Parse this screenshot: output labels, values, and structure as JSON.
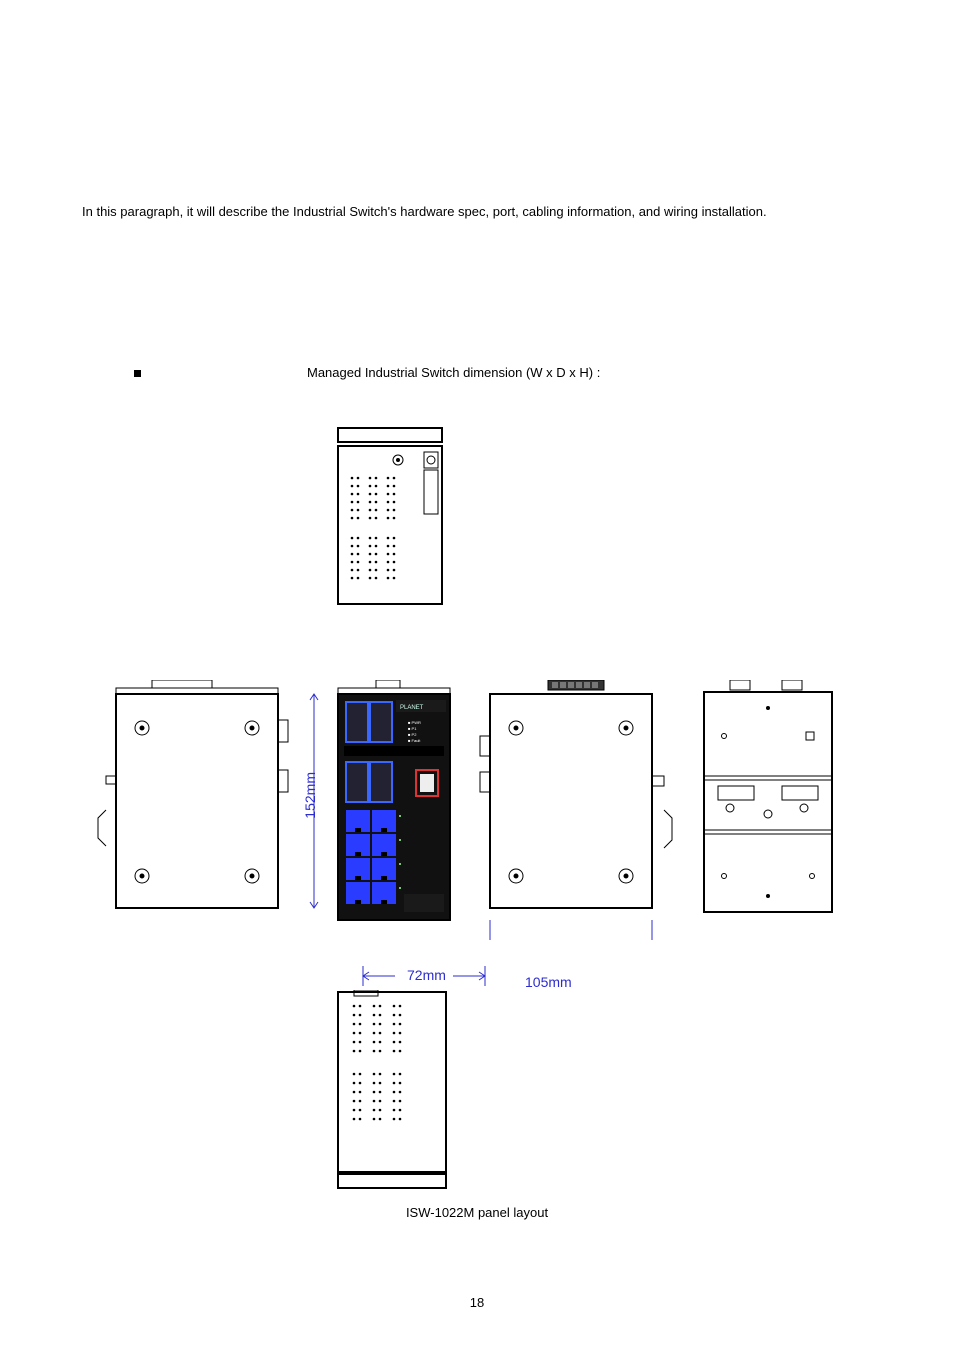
{
  "intro": "In this paragraph, it will describe the Industrial Switch's hardware spec, port, cabling information, and wiring installation.",
  "bullet_text": "Managed Industrial Switch dimension (W x D x H) :",
  "dimensions": {
    "width_mm": "72mm",
    "height_mm": "152mm",
    "depth_mm": "105mm"
  },
  "caption": "ISW-1022M panel layout",
  "page_number": "18"
}
